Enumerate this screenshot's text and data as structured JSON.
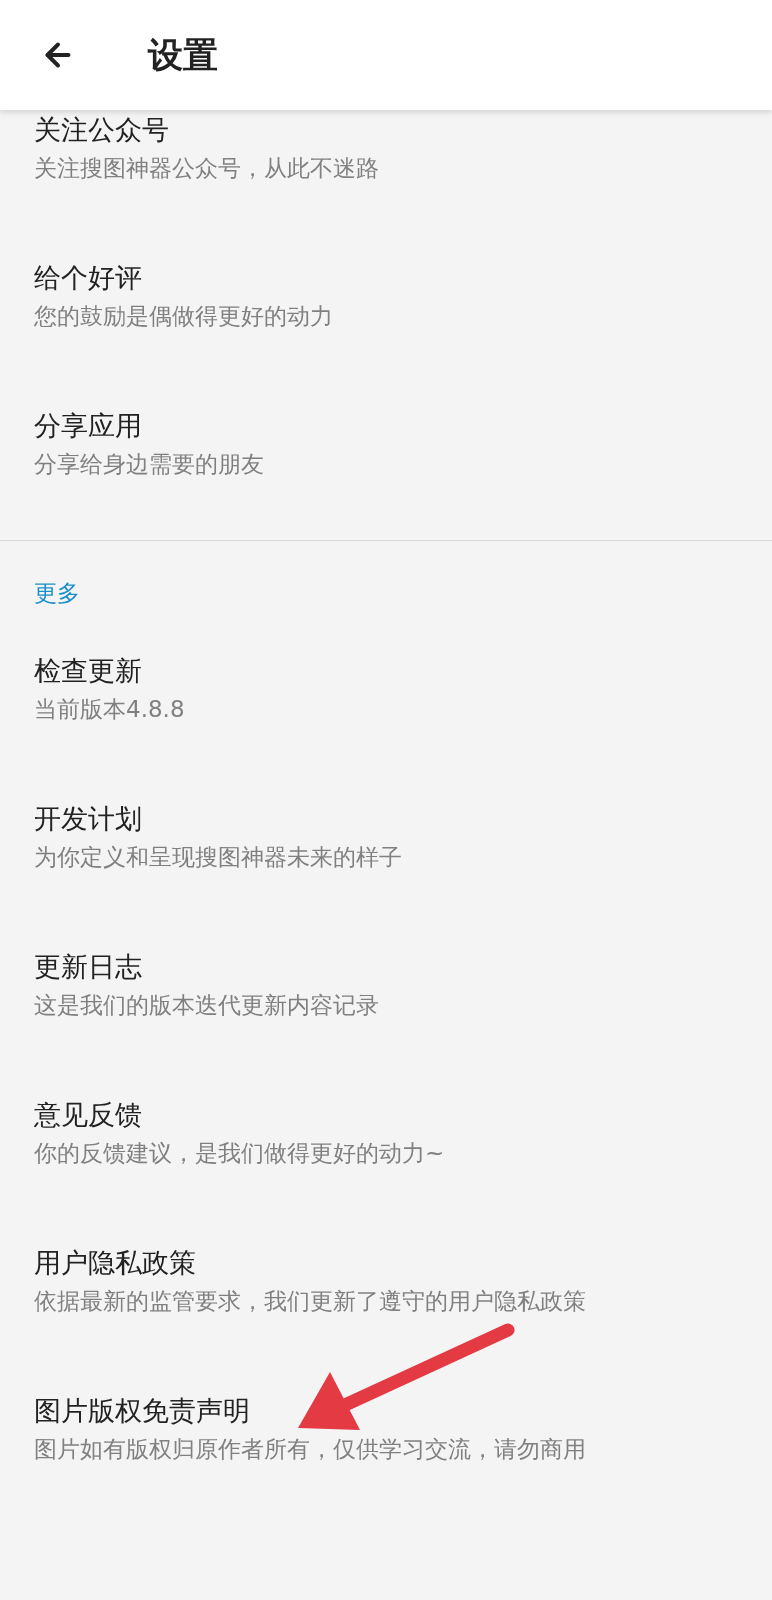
{
  "header": {
    "title": "设置"
  },
  "sections": [
    {
      "items": [
        {
          "title": "关注公众号",
          "subtitle": "关注搜图神器公众号，从此不迷路"
        },
        {
          "title": "给个好评",
          "subtitle": "您的鼓励是偶做得更好的动力"
        },
        {
          "title": "分享应用",
          "subtitle": "分享给身边需要的朋友"
        }
      ]
    },
    {
      "heading": "更多",
      "items": [
        {
          "title": "检查更新",
          "subtitle": "当前版本4.8.8"
        },
        {
          "title": "开发计划",
          "subtitle": "为你定义和呈现搜图神器未来的样子"
        },
        {
          "title": "更新日志",
          "subtitle": "这是我们的版本迭代更新内容记录"
        },
        {
          "title": "意见反馈",
          "subtitle": "你的反馈建议，是我们做得更好的动力~"
        },
        {
          "title": "用户隐私政策",
          "subtitle": "依据最新的监管要求，我们更新了遵守的用户隐私政策"
        },
        {
          "title": "图片版权免责声明",
          "subtitle": "图片如有版权归原作者所有，仅供学习交流，请勿商用"
        }
      ]
    }
  ]
}
